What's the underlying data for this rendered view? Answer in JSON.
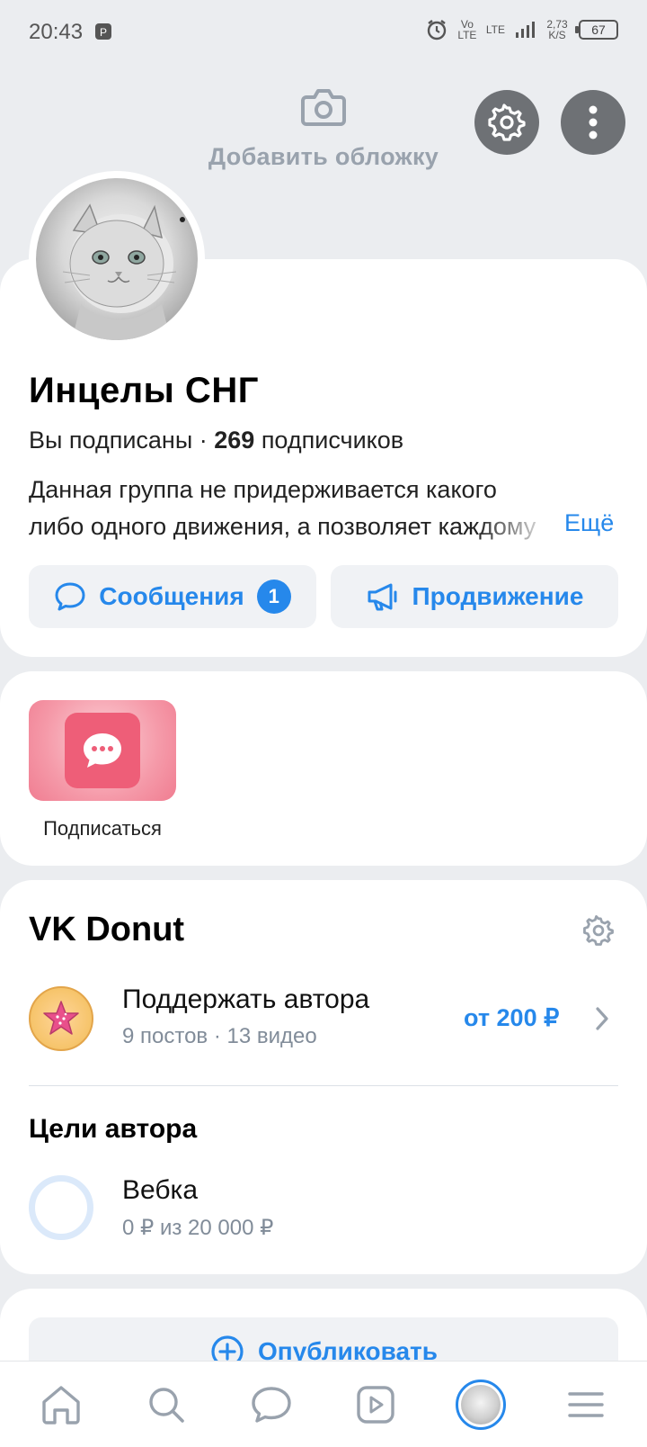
{
  "status_bar": {
    "time": "20:43",
    "network_1": "Vo LTE",
    "network_2": "LTE",
    "speed": "2,73 K/S",
    "battery": "67"
  },
  "cover": {
    "add_label": "Добавить обложку"
  },
  "group": {
    "name": "Инцелы СНГ",
    "subscribed": "Вы подписаны · ",
    "subscribers_count": "269",
    "subscribers_label": " подписчиков",
    "description_line1": "Данная группа не придерживается какого",
    "description_line2": "либо одного движения, а позволяет каждому",
    "more": "Ещё"
  },
  "actions": {
    "messages_label": "Сообщения",
    "messages_badge": "1",
    "promo_label": "Продвижение"
  },
  "subscribe_tile": {
    "label": "Подписаться"
  },
  "donut": {
    "title": "VK Donut",
    "support_title": "Поддержать автора",
    "support_meta": "9 постов · 13 видео",
    "price": "от 200 ₽",
    "goals_title": "Цели автора",
    "goal_name": "Вебка",
    "goal_meta": "0 ₽ из 20 000 ₽",
    "goal_progress": 0
  },
  "publish": {
    "label": "Опубликовать"
  },
  "colors": {
    "accent": "#2688eb",
    "background": "#ebedf0",
    "secondary_text": "#818c99"
  },
  "tabbar": {
    "items": [
      "home-icon",
      "search-icon",
      "messages-icon",
      "video-icon",
      "profile-avatar",
      "menu-icon"
    ]
  }
}
